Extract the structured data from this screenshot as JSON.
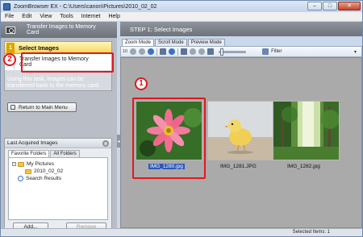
{
  "window": {
    "title": "ZoomBrowser EX - C:\\Users\\canon\\Pictures\\2010_02_02",
    "minimize_label": "–",
    "maximize_label": "□",
    "close_label": "✕"
  },
  "menu": [
    "File",
    "Edit",
    "View",
    "Tools",
    "Internet",
    "Help"
  ],
  "left_panel": {
    "header": "Transfer Images to Memory Card",
    "steps": [
      {
        "number": "1",
        "label": "Select Images"
      },
      {
        "number": "2",
        "label": "Transfer Images to Memory Card"
      }
    ],
    "hint": "Using this task, images can be transferred back to the memory card.",
    "return_button": "Return to Main Menu"
  },
  "acquired": {
    "title": "Last Acquired Images",
    "toggle": "⊗",
    "tabs": [
      "Favorite Folders",
      "All Folders"
    ],
    "tree": [
      {
        "label": "My Pictures"
      },
      {
        "label": "2010_02_02"
      },
      {
        "label": "Search Results"
      }
    ],
    "add_button": "Add...",
    "remove_button": "Remove"
  },
  "right_panel": {
    "header": "STEP 1: Select Images",
    "mode_tabs": [
      "Zoom Mode",
      "Scroll Mode",
      "Preview Mode"
    ],
    "toolbar_label": "10",
    "filter_label": "Filter",
    "filter_dropdown": "▾"
  },
  "images": [
    {
      "filename": "IMG_1280.jpg",
      "selected": true,
      "icon": "flower-photo"
    },
    {
      "filename": "IMG_1281.JPG",
      "selected": false,
      "icon": "chick-photo"
    },
    {
      "filename": "IMG_1282.jpg",
      "selected": false,
      "icon": "forest-photo"
    }
  ],
  "callouts": {
    "one": "1",
    "two": "2"
  },
  "status": {
    "text": "Selected Items: 1"
  },
  "colors": {
    "highlight": "#e0181e",
    "selection": "#2d58b8",
    "step_active": "#f5d75a"
  }
}
